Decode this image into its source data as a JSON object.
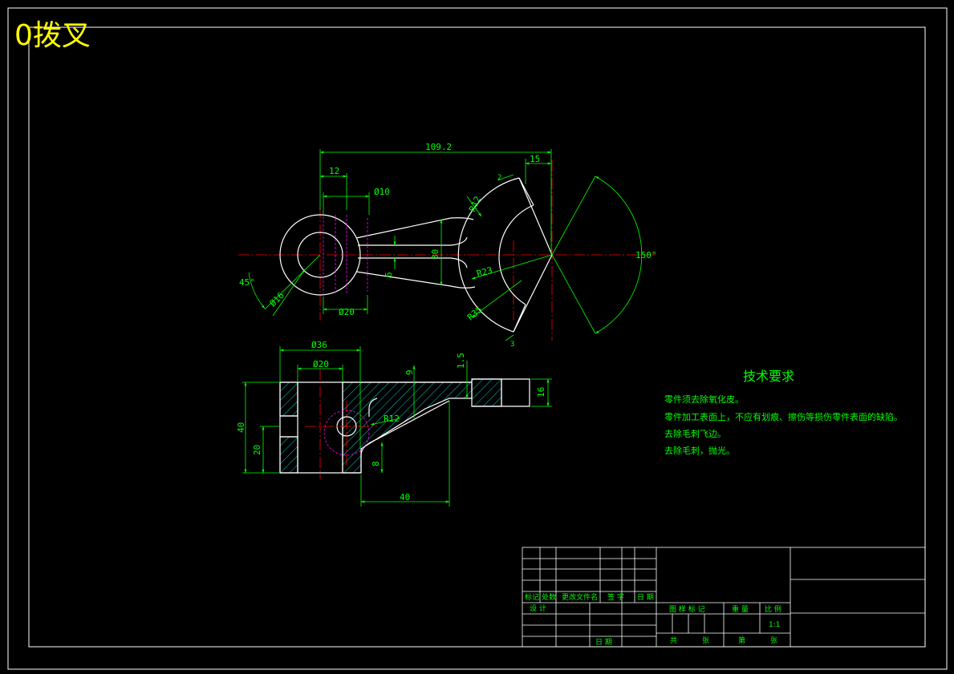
{
  "title": "0拨叉",
  "colors": {
    "background": "#000000",
    "outline": "#ffffff",
    "dimension": "#00ff00",
    "centerline": "#ff0000",
    "hidden": "#ff00ff",
    "hatch": "#00ffff",
    "title_text": "#ffff00"
  },
  "top_view": {
    "dim_overall": "109.2",
    "dim_12": "12",
    "dim_15": "15",
    "dim_phi10": "Ø10",
    "dim_r12": "R12",
    "dim_30": "30",
    "dim_6": "6",
    "dim_r23": "R23",
    "dim_r35": "R35",
    "dim_45deg": "45°",
    "dim_phi16": "Ø16",
    "dim_phi20": "Ø20",
    "dim_150deg": "150°",
    "dim_small_top": "2",
    "dim_small_bottom": "3"
  },
  "front_view": {
    "dim_phi36": "Ø36",
    "dim_phi20": "Ø20",
    "dim_9": "9",
    "dim_1_5": "1.5",
    "dim_16": "16",
    "dim_40_height": "40",
    "dim_20": "20",
    "dim_r12": "R12",
    "dim_8": "8",
    "dim_40_width": "40"
  },
  "tech_requirements": {
    "heading": "技术要求",
    "items": [
      "零件须去除氧化皮。",
      "零件加工表面上，不应有划痕、擦伤等损伤零件表面的缺陷。",
      "去除毛刺飞边。",
      "去除毛刺，抛光。"
    ]
  },
  "title_block": {
    "col_mark": "标记",
    "col_count": "处数",
    "col_doc": "更改文件名",
    "col_sign": "签 字",
    "col_date": "日 期",
    "row_design": "设 计",
    "row_date": "日 期",
    "stage_mark": "图 样 标 记",
    "weight": "重 量",
    "scale": "比 例",
    "scale_value": "1:1",
    "sheets_total": "共",
    "sheets_label": "张",
    "sheet_no": "第",
    "sheet_label": "张"
  }
}
